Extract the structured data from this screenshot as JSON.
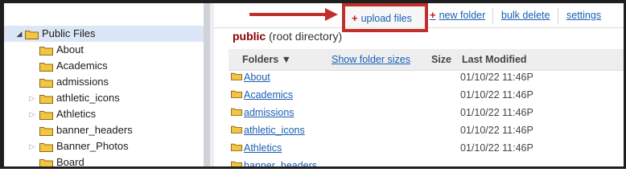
{
  "tree": {
    "items": [
      {
        "label": "Public Files",
        "expander": "open",
        "selected": true
      },
      {
        "label": "About",
        "expander": "none"
      },
      {
        "label": "Academics",
        "expander": "none"
      },
      {
        "label": "admissions",
        "expander": "none"
      },
      {
        "label": "athletic_icons",
        "expander": "closed"
      },
      {
        "label": "Athletics",
        "expander": "closed"
      },
      {
        "label": "banner_headers",
        "expander": "none"
      },
      {
        "label": "Banner_Photos",
        "expander": "closed"
      },
      {
        "label": "Board",
        "expander": "none"
      }
    ]
  },
  "toolbar": {
    "upload_label": "upload files",
    "new_folder_label": "new folder",
    "bulk_delete_label": "bulk delete",
    "settings_label": "settings",
    "plus_glyph": "+"
  },
  "location": {
    "folder": "public",
    "suffix": "(root directory)"
  },
  "table": {
    "headers": {
      "folders": "Folders ▼",
      "show_sizes": "Show folder sizes",
      "size": "Size",
      "modified": "Last Modified"
    },
    "rows": [
      {
        "name": "About",
        "modified": "01/10/22 11:46P"
      },
      {
        "name": "Academics",
        "modified": "01/10/22 11:46P"
      },
      {
        "name": "admissions",
        "modified": "01/10/22 11:46P"
      },
      {
        "name": "athletic_icons",
        "modified": "01/10/22 11:46P"
      },
      {
        "name": "Athletics",
        "modified": "01/10/22 11:46P"
      },
      {
        "name": "banner_headers",
        "modified": ""
      }
    ]
  },
  "colors": {
    "highlight": "#c0302a",
    "link": "#1a5fb4",
    "folder_fill": "#f5c542",
    "folder_stroke": "#8a6a10"
  }
}
